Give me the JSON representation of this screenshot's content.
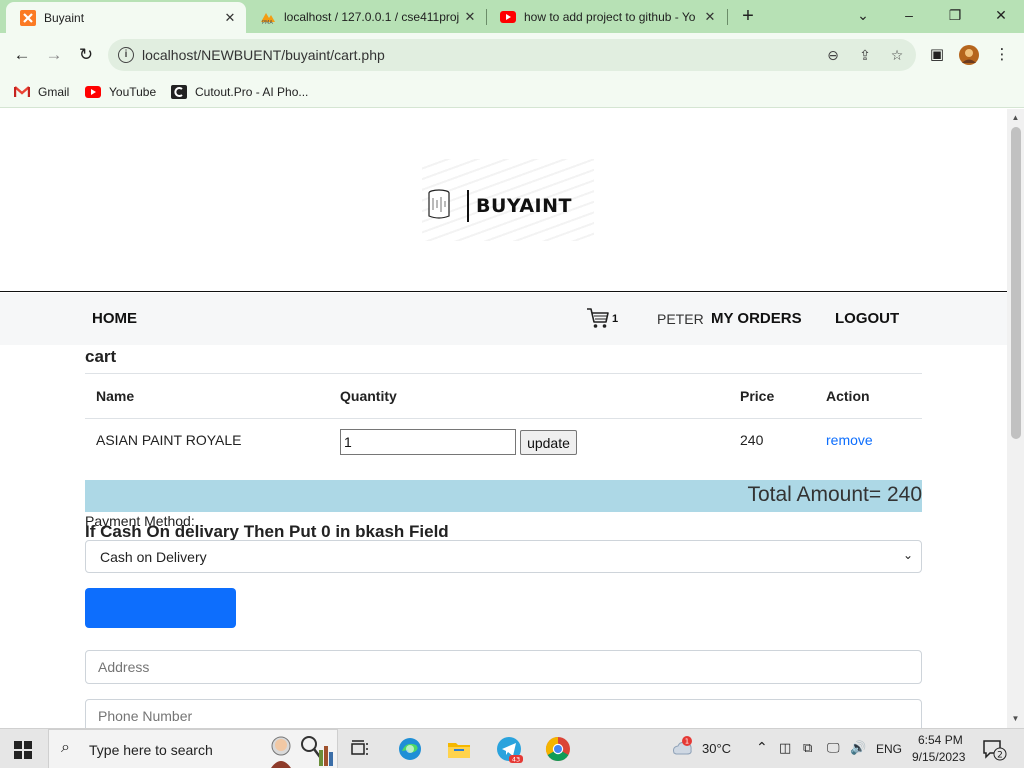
{
  "browser": {
    "tabs": [
      {
        "title": "Buyaint",
        "active": true
      },
      {
        "title": "localhost / 127.0.0.1 / cse411proj",
        "active": false
      },
      {
        "title": "how to add project to github - Yo",
        "active": false
      }
    ],
    "url": "localhost/NEWBUENT/buyaint/cart.php",
    "bookmarks": [
      {
        "label": "Gmail"
      },
      {
        "label": "YouTube"
      },
      {
        "label": "Cutout.Pro - AI Pho..."
      }
    ]
  },
  "site": {
    "logo_text": "BUYAINT",
    "nav": {
      "home": "HOME",
      "cart_count": "1",
      "user": "PETER",
      "orders": "MY ORDERS",
      "logout": "LOGOUT"
    }
  },
  "cart": {
    "heading": "cart",
    "columns": {
      "name": "Name",
      "quantity": "Quantity",
      "price": "Price",
      "action": "Action"
    },
    "rows": [
      {
        "name": "ASIAN PAINT ROYALE",
        "quantity": "1",
        "update_label": "update",
        "price": "240",
        "action_label": "remove"
      }
    ],
    "total_text": "Total Amount= 240"
  },
  "checkout": {
    "note": "If Cash On delivary Then Put 0 in bkash Field",
    "address_placeholder": "Address",
    "phone_placeholder": "Phone Number",
    "payment_label": "Payment Method:",
    "payment_selected": "Cash on Delivery"
  },
  "taskbar": {
    "search_placeholder": "Type here to search",
    "weather": "30°C",
    "language": "ENG",
    "time": "6:54 PM",
    "date": "9/15/2023",
    "notification_count": "2",
    "telegram_badge": "43",
    "weather_badge": "1"
  },
  "colors": {
    "tab_strip": "#b7e1b5",
    "total_bar": "#add8e6",
    "link": "#0d6efd",
    "primary_button": "#0d6efd"
  }
}
